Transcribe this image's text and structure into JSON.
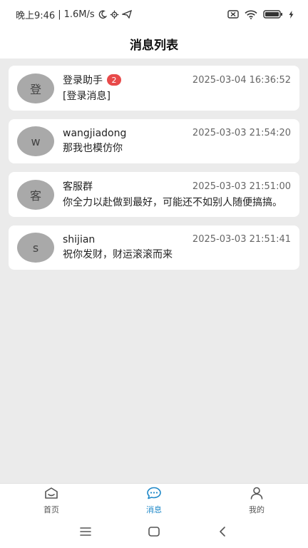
{
  "status_bar": {
    "time": "晚上9:46",
    "separator": "|",
    "net_speed": "1.6M/s"
  },
  "header": {
    "title": "消息列表"
  },
  "messages": [
    {
      "avatar": "登",
      "name": "登录助手",
      "badge": "2",
      "time": "2025-03-04 16:36:52",
      "preview": "[登录消息]"
    },
    {
      "avatar": "w",
      "name": "wangjiadong",
      "time": "2025-03-03 21:54:20",
      "preview": "那我也模仿你"
    },
    {
      "avatar": "客",
      "name": "客服群",
      "time": "2025-03-03 21:51:00",
      "preview": "你全力以赴做到最好，可能还不如别人随便搞搞。"
    },
    {
      "avatar": "s",
      "name": "shijian",
      "time": "2025-03-03 21:51:41",
      "preview": "祝你发财，财运滚滚而来"
    }
  ],
  "tabs": [
    {
      "label": "首页",
      "icon": "home-icon",
      "active": false
    },
    {
      "label": "消息",
      "icon": "chat-icon",
      "active": true
    },
    {
      "label": "我的",
      "icon": "user-icon",
      "active": false
    }
  ],
  "colors": {
    "accent": "#1e88c8",
    "badge": "#e84a4a",
    "avatar_bg": "#a9a9a9",
    "page_bg": "#ebebeb"
  }
}
